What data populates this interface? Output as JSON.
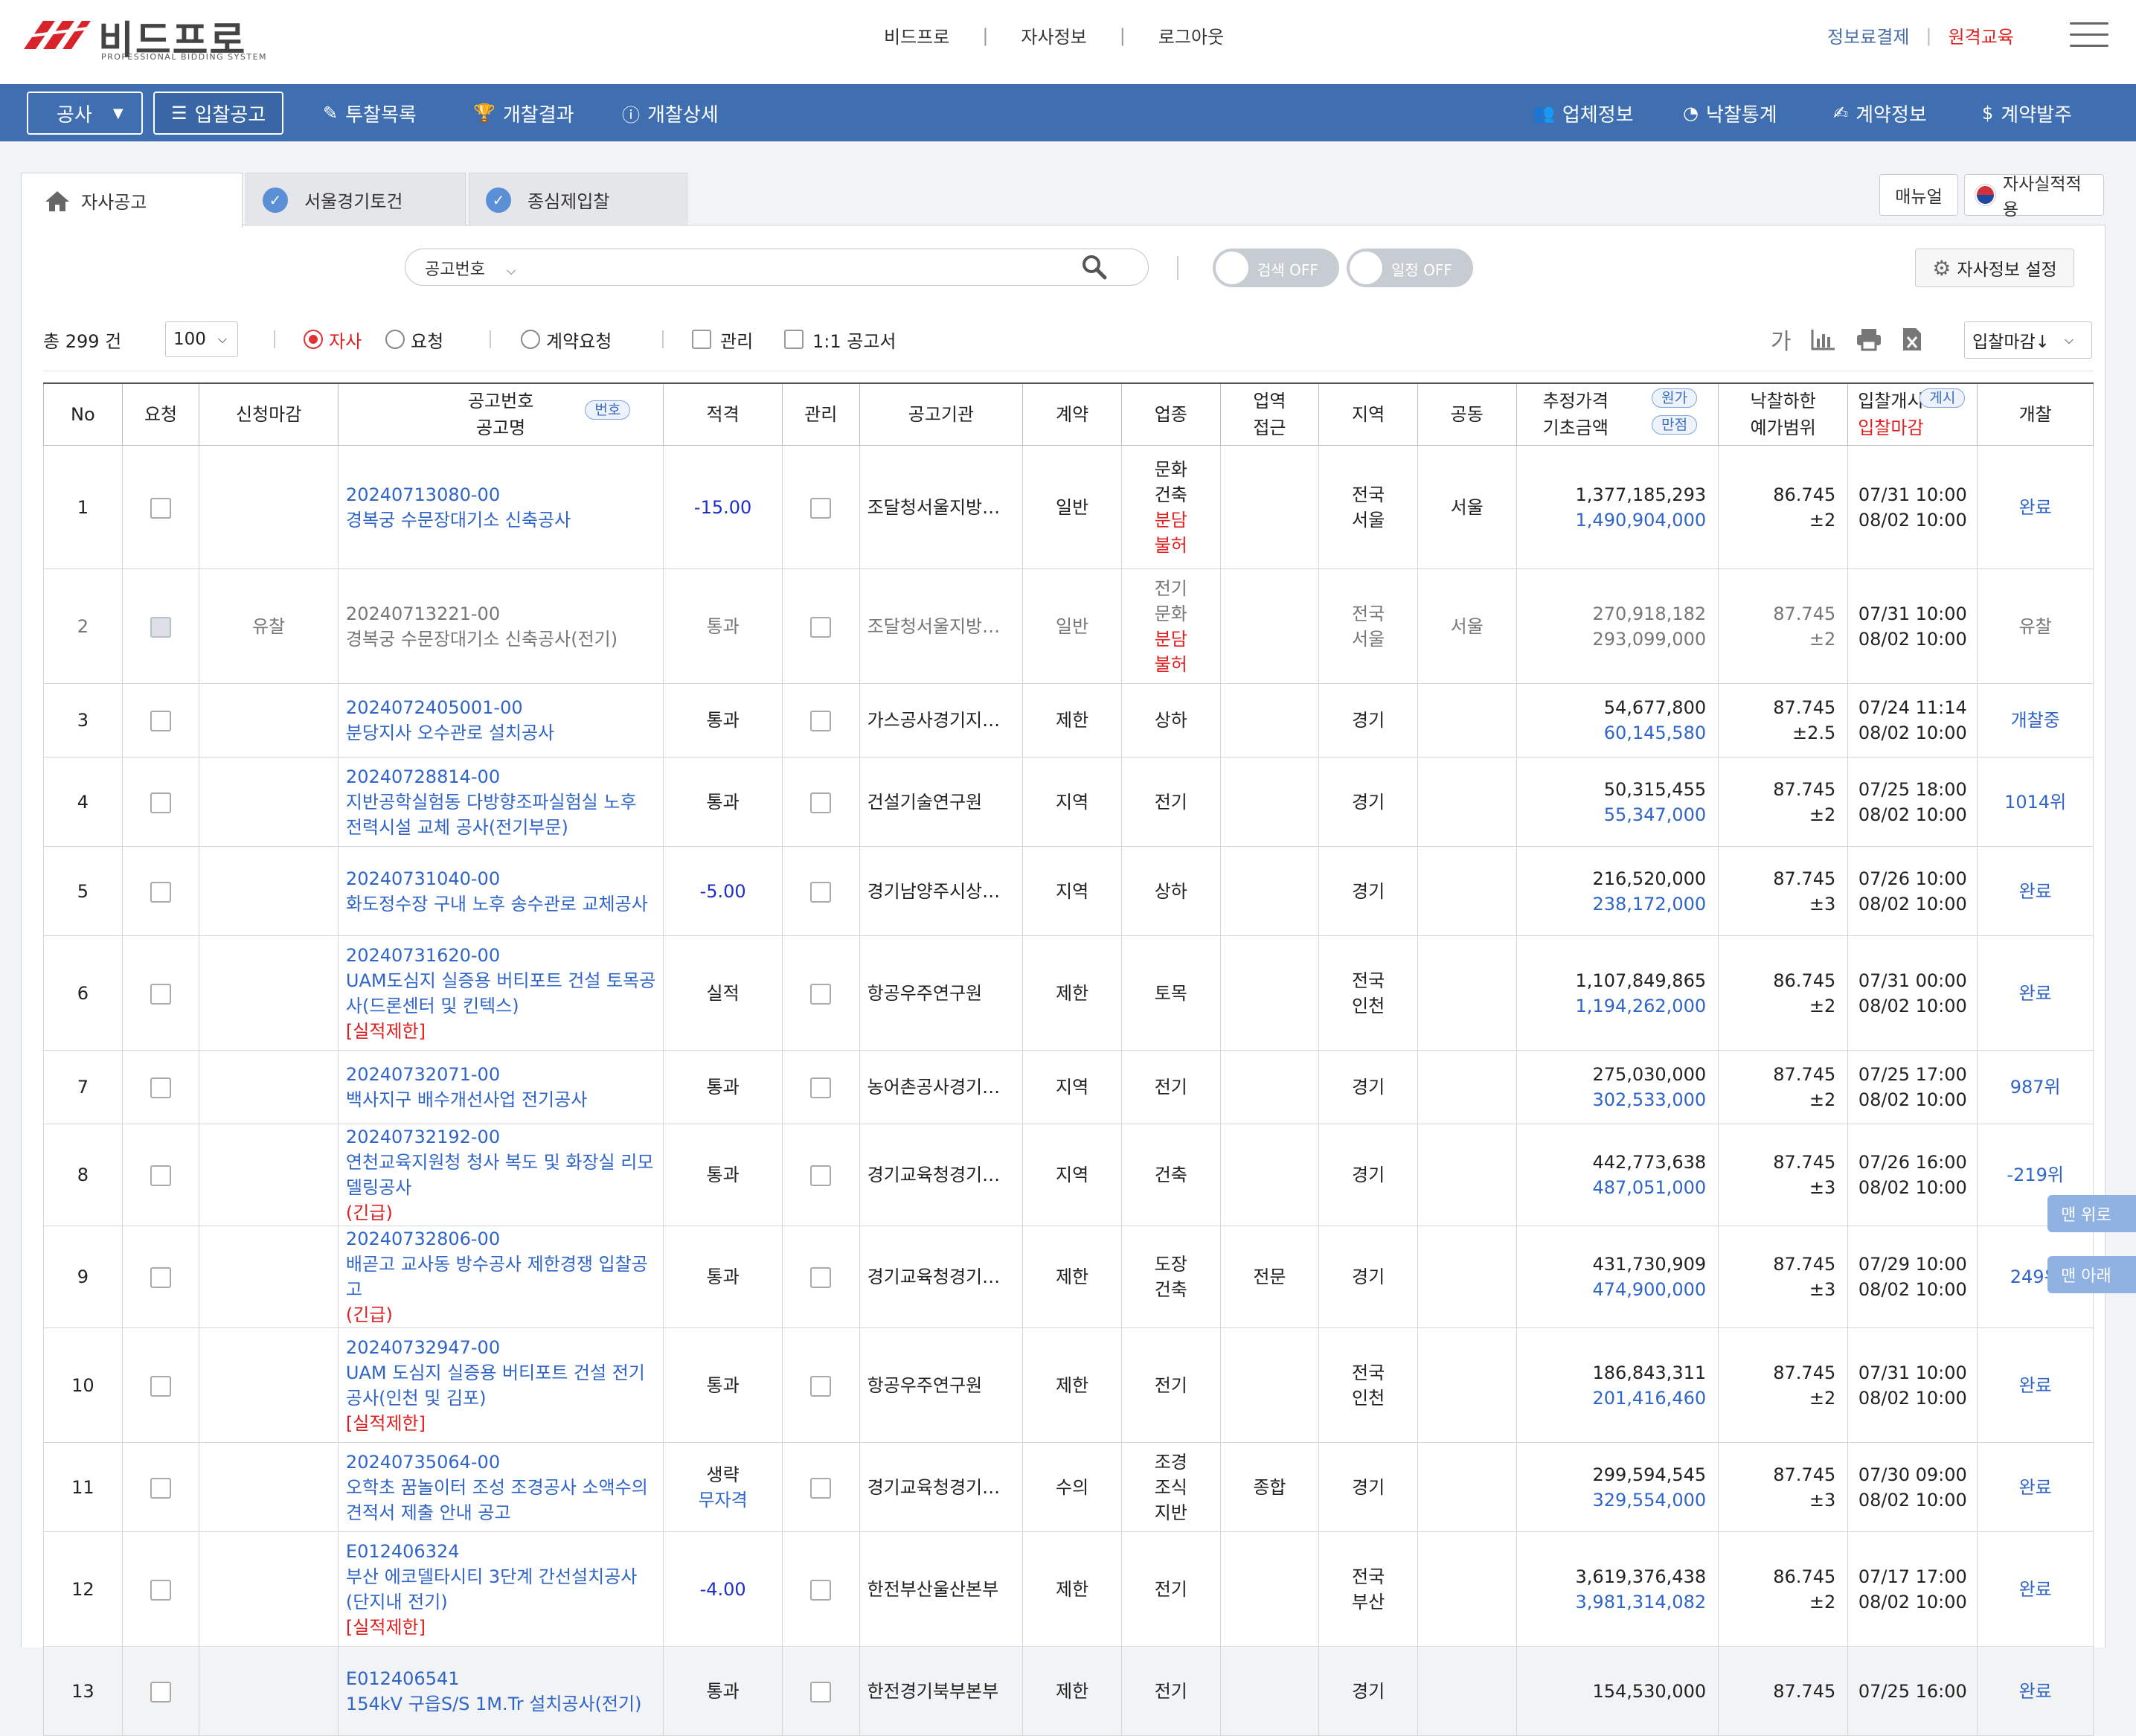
{
  "header": {
    "logo_title": "비드프로",
    "logo_sub": "PROFESSIONAL BIDDING SYSTEM",
    "center_links": [
      "비드프로",
      "자사정보",
      "로그아웃"
    ],
    "right_links": [
      {
        "label": "정보료결제",
        "color": "#4a6fa5"
      },
      {
        "label": "원격교육",
        "color": "#e02020"
      }
    ]
  },
  "nav": {
    "select_label": "공사",
    "items": [
      {
        "label": "입찰공고",
        "icon": "list-icon"
      },
      {
        "label": "투찰목록",
        "icon": "bid-list-icon"
      },
      {
        "label": "개찰결과",
        "icon": "trophy-icon"
      },
      {
        "label": "개찰상세",
        "icon": "info-icon"
      }
    ],
    "right_items": [
      {
        "label": "업체정보",
        "icon": "users-icon"
      },
      {
        "label": "낙찰통계",
        "icon": "pie-chart-icon"
      },
      {
        "label": "계약정보",
        "icon": "edit-document-icon"
      },
      {
        "label": "계약발주",
        "icon": "money-icon"
      }
    ]
  },
  "tabs": [
    {
      "label": "자사공고",
      "icon": "home-icon"
    },
    {
      "label": "서울경기토건",
      "icon": "check-circle-icon"
    },
    {
      "label": "종심제입찰",
      "icon": "check-circle-icon"
    }
  ],
  "top_buttons": {
    "manual": "매뉴얼",
    "apply": "자사실적적용"
  },
  "search": {
    "select": "공고번호",
    "toggle_search": "검색 OFF",
    "toggle_schedule": "일정 OFF",
    "settings": "자사정보 설정"
  },
  "filters": {
    "total": "총 299 건",
    "page_size": "100",
    "radio_company": "자사",
    "radio_request": "요청",
    "radio_contract_request": "계약요청",
    "check_manage": "관리",
    "check_one_to_one": "1:1 공고서",
    "font_tool": "가",
    "sort": "입찰마감↓"
  },
  "table": {
    "headers": {
      "no": "No",
      "request": "요청",
      "apply_deadline": "신청마감",
      "notice_no": "공고번호",
      "notice_name": "공고명",
      "notice_pill": "번호",
      "qualified": "적격",
      "manage": "관리",
      "agency": "공고기관",
      "contract": "계약",
      "industry": "업종",
      "scope_1": "업역",
      "scope_2": "접근",
      "region": "지역",
      "joint": "공동",
      "est_price": "추정가격",
      "base_amount": "기초금액",
      "pill_cost": "원가",
      "pill_full": "만점",
      "lower_limit": "낙찰하한",
      "price_range": "예가범위",
      "bid_start": "입찰개시",
      "bid_close": "입찰마감",
      "pill_post": "게시",
      "opening": "개찰"
    },
    "rows": [
      {
        "no": "1",
        "req_disabled": false,
        "deadline": "",
        "code": "20240713080-00",
        "title": "경복궁 수문장대기소 신축공사",
        "note": "",
        "grade": "-15.00",
        "grade_style": "neg",
        "agency": "조달청서울지방…",
        "contract": "일반",
        "industry": [
          "문화",
          "건축"
        ],
        "industry_red": [
          "분담",
          "불허"
        ],
        "scope": "",
        "region": [
          "전국",
          "서울"
        ],
        "joint": "서울",
        "est": "1,377,185,293",
        "base": "1,490,904,000",
        "limit": "86.745",
        "range": "±2",
        "start": "07/31 10:00",
        "close": "08/02 10:00",
        "open": "완료",
        "muted": false,
        "h": 166
      },
      {
        "no": "2",
        "req_disabled": true,
        "deadline": "유찰",
        "code": "20240713221-00",
        "title": "경복궁 수문장대기소 신축공사(전기)",
        "note": "",
        "grade": "통과",
        "grade_style": "",
        "agency": "조달청서울지방…",
        "contract": "일반",
        "industry": [
          "전기",
          "문화"
        ],
        "industry_red": [
          "분담",
          "불허"
        ],
        "scope": "",
        "region": [
          "전국",
          "서울"
        ],
        "joint": "서울",
        "est": "270,918,182",
        "base": "293,099,000",
        "limit": "87.745",
        "range": "±2",
        "start": "07/31 10:00",
        "close": "08/02 10:00",
        "open": "유찰",
        "muted": true,
        "h": 154
      },
      {
        "no": "3",
        "req_disabled": false,
        "deadline": "",
        "code": "2024072405001-00",
        "title": "분당지사 오수관로 설치공사",
        "note": "",
        "grade": "통과",
        "grade_style": "",
        "agency": "가스공사경기지…",
        "contract": "제한",
        "industry": [
          "상하"
        ],
        "industry_red": [],
        "scope": "",
        "region": [
          "경기"
        ],
        "joint": "",
        "est": "54,677,800",
        "base": "60,145,580",
        "limit": "87.745",
        "range": "±2.5",
        "start": "07/24 11:14",
        "close": "08/02 10:00",
        "open": "개찰중",
        "muted": false,
        "h": 99
      },
      {
        "no": "4",
        "req_disabled": false,
        "deadline": "",
        "code": "20240728814-00",
        "title": "지반공학실험동 다방향조파실험실 노후 전력시설 교체 공사(전기부문)",
        "note": "",
        "grade": "통과",
        "grade_style": "",
        "agency": "건설기술연구원",
        "contract": "지역",
        "industry": [
          "전기"
        ],
        "industry_red": [],
        "scope": "",
        "region": [
          "경기"
        ],
        "joint": "",
        "est": "50,315,455",
        "base": "55,347,000",
        "limit": "87.745",
        "range": "±2",
        "start": "07/25 18:00",
        "close": "08/02 10:00",
        "open": "1014위",
        "muted": false,
        "h": 120
      },
      {
        "no": "5",
        "req_disabled": false,
        "deadline": "",
        "code": "20240731040-00",
        "title": "화도정수장 구내 노후 송수관로 교체공사",
        "note": "",
        "grade": "-5.00",
        "grade_style": "neg",
        "agency": "경기남양주시상…",
        "contract": "지역",
        "industry": [
          "상하"
        ],
        "industry_red": [],
        "scope": "",
        "region": [
          "경기"
        ],
        "joint": "",
        "est": "216,520,000",
        "base": "238,172,000",
        "limit": "87.745",
        "range": "±3",
        "start": "07/26 10:00",
        "close": "08/02 10:00",
        "open": "완료",
        "muted": false,
        "h": 120
      },
      {
        "no": "6",
        "req_disabled": false,
        "deadline": "",
        "code": "20240731620-00",
        "title": "UAM도심지 실증용 버티포트 건설 토목공사(드론센터 및 킨텍스)",
        "note": "[실적제한]",
        "grade": "실적",
        "grade_style": "",
        "agency": "항공우주연구원",
        "contract": "제한",
        "industry": [
          "토목"
        ],
        "industry_red": [],
        "scope": "",
        "region": [
          "전국",
          "인천"
        ],
        "joint": "",
        "est": "1,107,849,865",
        "base": "1,194,262,000",
        "limit": "86.745",
        "range": "±2",
        "start": "07/31 00:00",
        "close": "08/02 10:00",
        "open": "완료",
        "muted": false,
        "h": 154
      },
      {
        "no": "7",
        "req_disabled": false,
        "deadline": "",
        "code": "20240732071-00",
        "title": "백사지구 배수개선사업 전기공사",
        "note": "",
        "grade": "통과",
        "grade_style": "",
        "agency": "농어촌공사경기…",
        "contract": "지역",
        "industry": [
          "전기"
        ],
        "industry_red": [],
        "scope": "",
        "region": [
          "경기"
        ],
        "joint": "",
        "est": "275,030,000",
        "base": "302,533,000",
        "limit": "87.745",
        "range": "±2",
        "start": "07/25 17:00",
        "close": "08/02 10:00",
        "open": "987위",
        "muted": false,
        "h": 99
      },
      {
        "no": "8",
        "req_disabled": false,
        "deadline": "",
        "code": "20240732192-00",
        "title": "연천교육지원청 청사 복도 및 화장실 리모델링공사",
        "note": "(긴급)",
        "grade": "통과",
        "grade_style": "",
        "agency": "경기교육청경기…",
        "contract": "지역",
        "industry": [
          "건축"
        ],
        "industry_red": [],
        "scope": "",
        "region": [
          "경기"
        ],
        "joint": "",
        "est": "442,773,638",
        "base": "487,051,000",
        "limit": "87.745",
        "range": "±3",
        "start": "07/26 16:00",
        "close": "08/02 10:00",
        "open": "-219위",
        "muted": false,
        "h": 120
      },
      {
        "no": "9",
        "req_disabled": false,
        "deadline": "",
        "code": "20240732806-00",
        "title": "배곧고 교사동 방수공사 제한경쟁 입찰공고",
        "note": "(긴급)",
        "grade": "통과",
        "grade_style": "",
        "agency": "경기교육청경기…",
        "contract": "제한",
        "industry": [
          "도장",
          "건축"
        ],
        "industry_red": [],
        "scope": "전문",
        "region": [
          "경기"
        ],
        "joint": "",
        "est": "431,730,909",
        "base": "474,900,000",
        "limit": "87.745",
        "range": "±3",
        "start": "07/29 10:00",
        "close": "08/02 10:00",
        "open": "249위",
        "muted": false,
        "h": 120
      },
      {
        "no": "10",
        "req_disabled": false,
        "deadline": "",
        "code": "20240732947-00",
        "title": "UAM 도심지 실증용 버티포트 건설 전기공사(인천 및 김포)",
        "note": "[실적제한]",
        "grade": "통과",
        "grade_style": "",
        "agency": "항공우주연구원",
        "contract": "제한",
        "industry": [
          "전기"
        ],
        "industry_red": [],
        "scope": "",
        "region": [
          "전국",
          "인천"
        ],
        "joint": "",
        "est": "186,843,311",
        "base": "201,416,460",
        "limit": "87.745",
        "range": "±2",
        "start": "07/31 10:00",
        "close": "08/02 10:00",
        "open": "완료",
        "muted": false,
        "h": 154
      },
      {
        "no": "11",
        "req_disabled": false,
        "deadline": "",
        "code": "20240735064-00",
        "title": "오학초 꿈놀이터 조성 조경공사 소액수의 견적서 제출 안내 공고",
        "note": "",
        "grade": "생략",
        "grade2": "무자격",
        "grade_style": "",
        "agency": "경기교육청경기…",
        "contract": "수의",
        "industry": [
          "조경",
          "조식",
          "지반"
        ],
        "industry_red": [],
        "scope": "종합",
        "region": [
          "경기"
        ],
        "joint": "",
        "est": "299,594,545",
        "base": "329,554,000",
        "limit": "87.745",
        "range": "±3",
        "start": "07/30 09:00",
        "close": "08/02 10:00",
        "open": "완료",
        "muted": false,
        "h": 120
      },
      {
        "no": "12",
        "req_disabled": false,
        "deadline": "",
        "code": "E012406324",
        "title": "부산 에코델타시티 3단계 간선설치공사(단지내 전기)",
        "note": "[실적제한]",
        "grade": "-4.00",
        "grade_style": "neg",
        "agency": "한전부산울산본부",
        "contract": "제한",
        "industry": [
          "전기"
        ],
        "industry_red": [],
        "scope": "",
        "region": [
          "전국",
          "부산"
        ],
        "joint": "",
        "est": "3,619,376,438",
        "base": "3,981,314,082",
        "limit": "86.745",
        "range": "±2",
        "start": "07/17 17:00",
        "close": "08/02 10:00",
        "open": "완료",
        "muted": false,
        "h": 154
      },
      {
        "no": "13",
        "req_disabled": false,
        "deadline": "",
        "code": "E012406541",
        "title": "154kV 구읍S/S 1M.Tr 설치공사(전기)",
        "note": "",
        "grade": "통과",
        "grade_style": "",
        "agency": "한전경기북부본부",
        "contract": "제한",
        "industry": [
          "전기"
        ],
        "industry_red": [],
        "scope": "",
        "region": [
          "경기"
        ],
        "joint": "",
        "est": "154,530,000",
        "base": "",
        "limit": "87.745",
        "range": "",
        "start": "07/25 16:00",
        "close": "",
        "open": "완료",
        "muted": false,
        "h": 120
      }
    ]
  },
  "side_buttons": {
    "top": "맨 위로",
    "bottom": "맨 아래"
  },
  "colors": {
    "nav": "#3f6fb1",
    "link": "#2f64c8",
    "red": "#e02020",
    "neg": "#1c2fc8"
  }
}
